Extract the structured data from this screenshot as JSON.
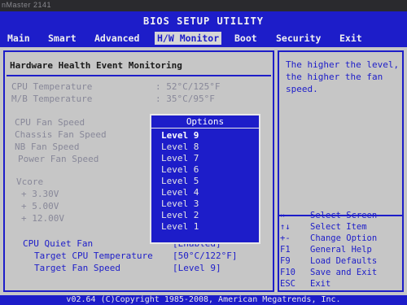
{
  "bezel": {
    "text": "nMaster 2141"
  },
  "bios": {
    "title": "BIOS SETUP UTILITY",
    "menu": [
      {
        "label": "Main"
      },
      {
        "label": "Smart"
      },
      {
        "label": "Advanced"
      },
      {
        "label": "H/W Monitor",
        "active": true
      },
      {
        "label": "Boot"
      },
      {
        "label": "Security"
      },
      {
        "label": "Exit"
      }
    ],
    "section_title": "Hardware Health Event Monitoring",
    "temps": [
      {
        "label": "CPU Temperature",
        "value": ": 52°C/125°F"
      },
      {
        "label": "M/B Temperature",
        "value": ": 35°C/95°F"
      }
    ],
    "fans": [
      {
        "label": "CPU Fan Speed"
      },
      {
        "label": "Chassis Fan Speed"
      },
      {
        "label": "NB Fan Speed"
      },
      {
        "label": "Power Fan Speed"
      }
    ],
    "vcore": {
      "label": "Vcore",
      "rails": [
        "+ 3.30V",
        "+ 5.00V",
        "+ 12.00V"
      ]
    },
    "quiet_fan": {
      "label": "CPU Quiet Fan",
      "value": "[Enabled]"
    },
    "target_temp": {
      "label": "Target CPU Temperature",
      "value": "[50°C/122°F]"
    },
    "target_speed": {
      "label": "Target Fan Speed",
      "value": "[Level 9]"
    },
    "options_popup": {
      "title": "Options",
      "items": [
        "Level 9",
        "Level 8",
        "Level 7",
        "Level 6",
        "Level 5",
        "Level 4",
        "Level 3",
        "Level 2",
        "Level 1"
      ],
      "selected": "Level 9"
    },
    "help": {
      "text": "The higher the level, the higher the fan speed."
    },
    "keys": [
      {
        "key": "↔",
        "desc": "Select Screen"
      },
      {
        "key": "↑↓",
        "desc": "Select Item"
      },
      {
        "key": "+-",
        "desc": "Change Option"
      },
      {
        "key": "F1",
        "desc": "General Help"
      },
      {
        "key": "F9",
        "desc": "Load Defaults"
      },
      {
        "key": "F10",
        "desc": "Save and Exit"
      },
      {
        "key": "ESC",
        "desc": "Exit"
      }
    ],
    "footer": "v02.64 (C)Copyright 1985-2008, American Megatrends, Inc."
  },
  "colors": {
    "bios_blue": "#1d1dc9",
    "panel_gray": "#c6c6c6",
    "dim_text": "#888899"
  }
}
